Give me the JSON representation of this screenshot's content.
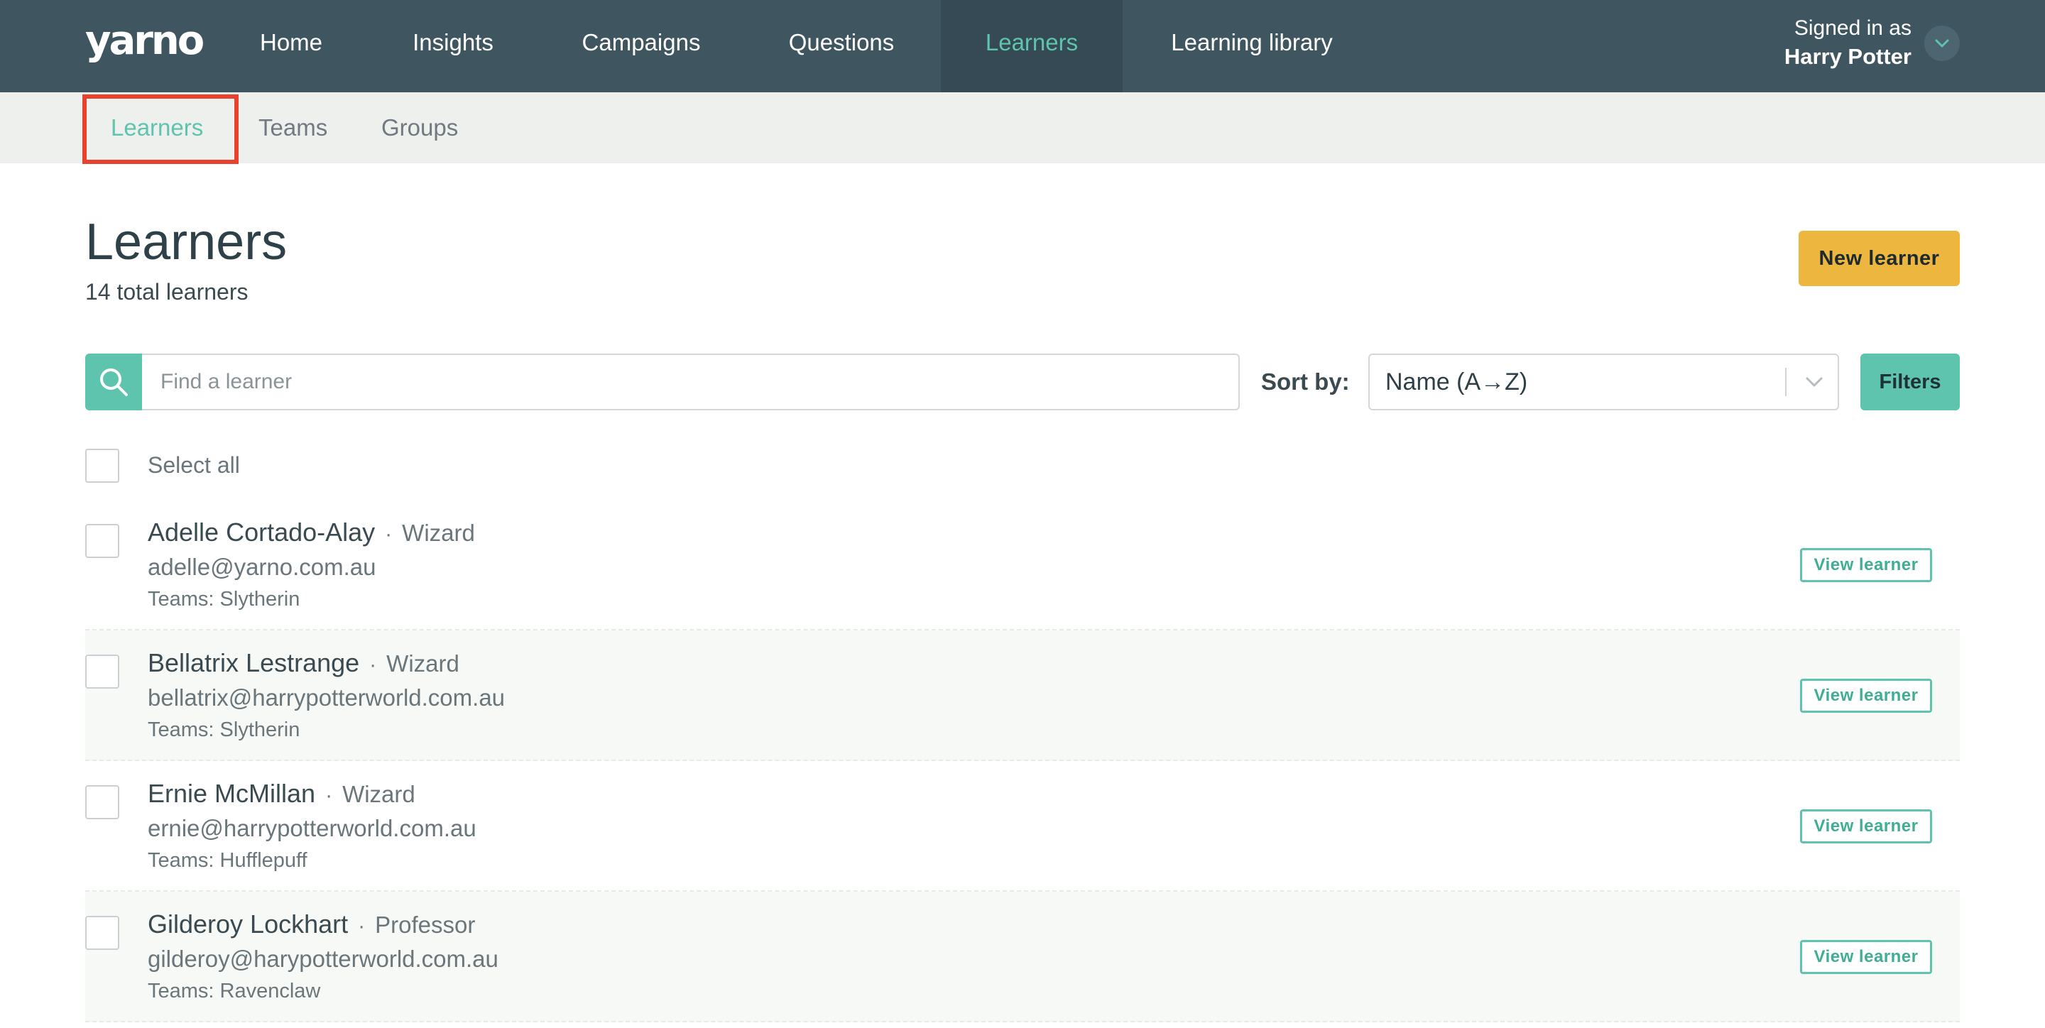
{
  "app": {
    "logo": "yarno"
  },
  "nav": {
    "items": [
      {
        "label": "Home"
      },
      {
        "label": "Insights"
      },
      {
        "label": "Campaigns"
      },
      {
        "label": "Questions"
      },
      {
        "label": "Learners",
        "active": true
      },
      {
        "label": "Learning library"
      }
    ],
    "user": {
      "signed_in_label": "Signed in as",
      "name": "Harry Potter",
      "toggle_icon": "chevron-down-icon"
    }
  },
  "subnav": {
    "items": [
      {
        "label": "Learners",
        "active": true
      },
      {
        "label": "Teams"
      },
      {
        "label": "Groups"
      }
    ],
    "highlight_color": "#e8422e"
  },
  "page": {
    "title": "Learners",
    "subtitle": "14 total learners",
    "new_button": "New learner"
  },
  "search": {
    "placeholder": "Find a learner",
    "value": "",
    "icon": "search-icon"
  },
  "sort": {
    "label": "Sort by:",
    "value": "Name (A→Z)"
  },
  "filters_button": "Filters",
  "select_all_label": "Select all",
  "learners": [
    {
      "name": "Adelle Cortado-Alay",
      "sep": "·",
      "role": "Wizard",
      "email": "adelle@yarno.com.au",
      "teams": "Teams: Slytherin",
      "action": "View learner"
    },
    {
      "name": "Bellatrix Lestrange",
      "sep": "·",
      "role": "Wizard",
      "email": "bellatrix@harrypotterworld.com.au",
      "teams": "Teams: Slytherin",
      "action": "View learner"
    },
    {
      "name": "Ernie McMillan",
      "sep": "·",
      "role": "Wizard",
      "email": "ernie@harrypotterworld.com.au",
      "teams": "Teams: Hufflepuff",
      "action": "View learner"
    },
    {
      "name": "Gilderoy Lockhart",
      "sep": "·",
      "role": "Professor",
      "email": "gilderoy@harypotterworld.com.au",
      "teams": "Teams: Ravenclaw",
      "action": "View learner"
    }
  ],
  "colors": {
    "nav_bg": "#3f5661",
    "accent": "#5ec4ad",
    "primary_button": "#edb63f"
  }
}
